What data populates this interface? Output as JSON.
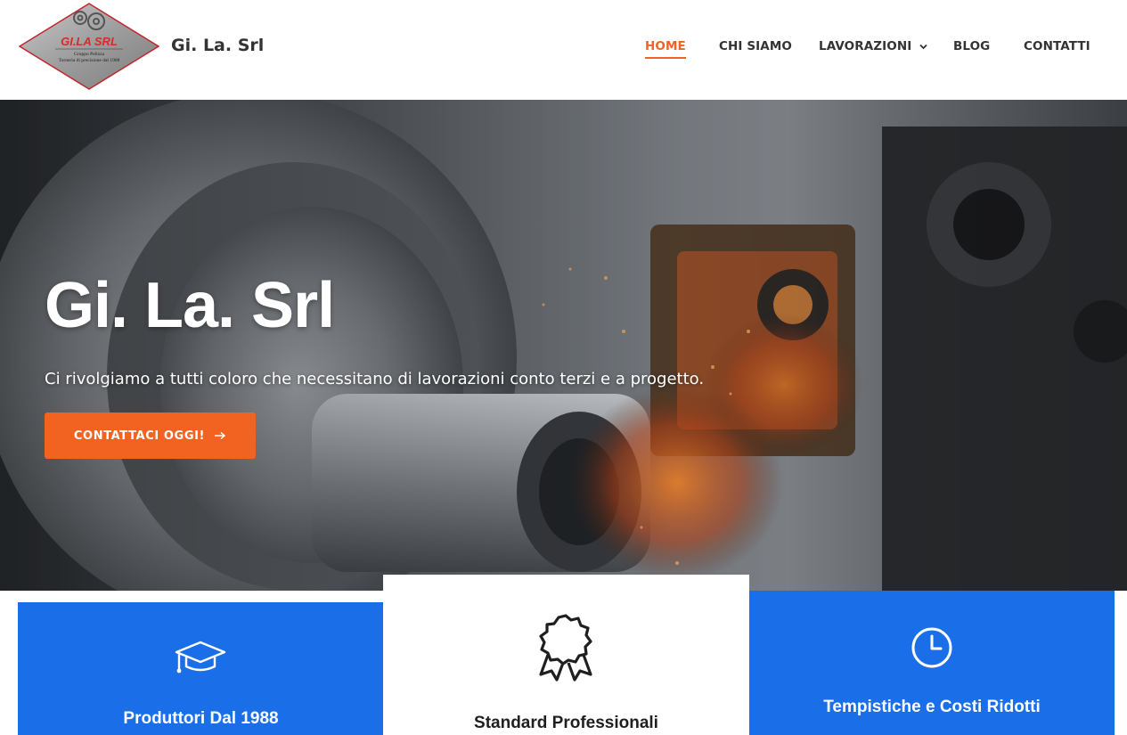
{
  "site": {
    "title": "Gi. La. Srl",
    "logo": {
      "brand": "GI.LA SRL",
      "line1": "Gruppo Pelizza",
      "line2": "Torneria di precisione dal 1988"
    }
  },
  "nav": {
    "items": [
      {
        "label": "HOME",
        "active": true
      },
      {
        "label": "CHI SIAMO",
        "active": false
      },
      {
        "label": "LAVORAZIONI",
        "active": false,
        "has_dropdown": true
      },
      {
        "label": "BLOG",
        "active": false
      },
      {
        "label": "CONTATTI",
        "active": false
      }
    ]
  },
  "hero": {
    "title": "Gi. La. Srl",
    "subtitle": "Ci rivolgiamo a tutti coloro che necessitano di lavorazioni conto terzi e a progetto.",
    "cta_label": "CONTATTACI OGGI!"
  },
  "features": [
    {
      "title": "Produttori Dal 1988",
      "icon": "graduation-cap-icon"
    },
    {
      "title": "Standard Professionali",
      "icon": "award-badge-icon"
    },
    {
      "title": "Tempistiche e Costi Ridotti",
      "icon": "clock-icon"
    }
  ],
  "colors": {
    "accent": "#f26322",
    "feature_blue": "#1a6fe8",
    "text_dark": "#333333"
  }
}
